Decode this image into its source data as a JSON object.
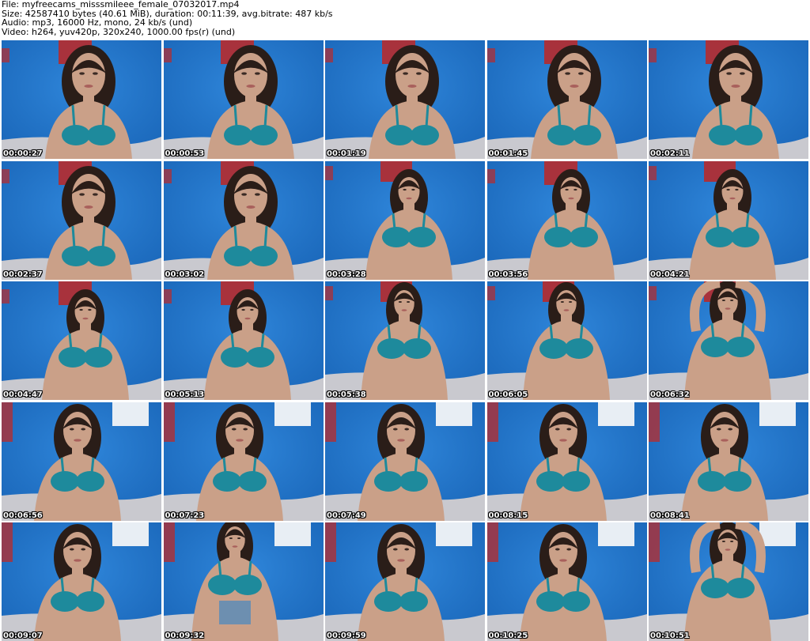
{
  "header": {
    "lines": [
      "File: myfreecams_misssmileee_female_07032017.mp4",
      "Size: 42587410 bytes (40.61 MiB), duration: 00:11:39, avg.bitrate: 487 kb/s",
      "Audio: mp3, 16000 Hz, mono, 24 kb/s (und)",
      "Video: h264, yuv420p, 320x240, 1000.00 fps(r) (und)"
    ]
  },
  "thumbnails": [
    {
      "timestamp": "00:00:27"
    },
    {
      "timestamp": "00:00:53"
    },
    {
      "timestamp": "00:01:19"
    },
    {
      "timestamp": "00:01:45"
    },
    {
      "timestamp": "00:02:11"
    },
    {
      "timestamp": "00:02:37"
    },
    {
      "timestamp": "00:03:02"
    },
    {
      "timestamp": "00:03:28"
    },
    {
      "timestamp": "00:03:56"
    },
    {
      "timestamp": "00:04:21"
    },
    {
      "timestamp": "00:04:47"
    },
    {
      "timestamp": "00:05:13"
    },
    {
      "timestamp": "00:05:38"
    },
    {
      "timestamp": "00:06:05"
    },
    {
      "timestamp": "00:06:32"
    },
    {
      "timestamp": "00:06:56"
    },
    {
      "timestamp": "00:07:23"
    },
    {
      "timestamp": "00:07:49"
    },
    {
      "timestamp": "00:08:15"
    },
    {
      "timestamp": "00:08:41"
    },
    {
      "timestamp": "00:09:07"
    },
    {
      "timestamp": "00:09:32"
    },
    {
      "timestamp": "00:09:59"
    },
    {
      "timestamp": "00:10:25"
    },
    {
      "timestamp": "00:10:51"
    }
  ],
  "colors": {
    "wall": "#1f73c9",
    "wall_dark": "#1459a8",
    "bed": "#c9c9cf",
    "skin": "#caa088",
    "hair": "#2a1d18",
    "bra": "#1e8a9c",
    "poster": "#a8323c"
  }
}
